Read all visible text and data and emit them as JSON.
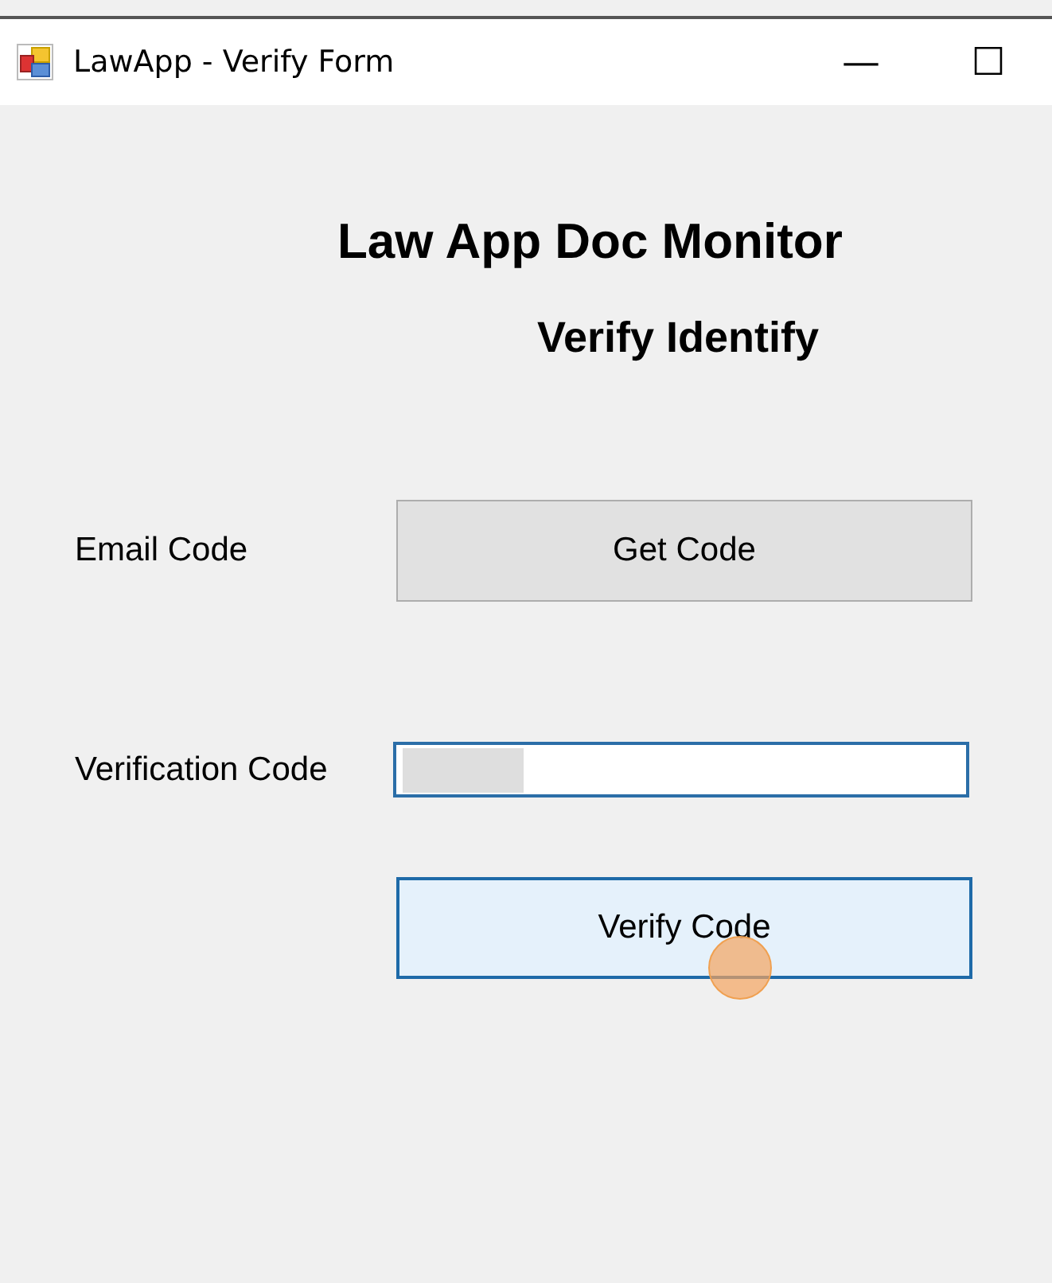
{
  "window": {
    "title": "LawApp - Verify Form",
    "controls": [
      "—",
      "☐"
    ]
  },
  "headings": [
    "Law App Doc Monitor",
    "Verify Identify"
  ],
  "rows": [
    {
      "kind": "button",
      "label": "Email Code",
      "button": {
        "label": "Get Code",
        "hovered": false
      }
    },
    {
      "kind": "field",
      "label": "Verification Code",
      "field": {
        "redacted": true
      }
    },
    {
      "kind": "button",
      "button": {
        "label": "Verify Code",
        "hovered": true
      }
    }
  ],
  "click_indicator": true
}
